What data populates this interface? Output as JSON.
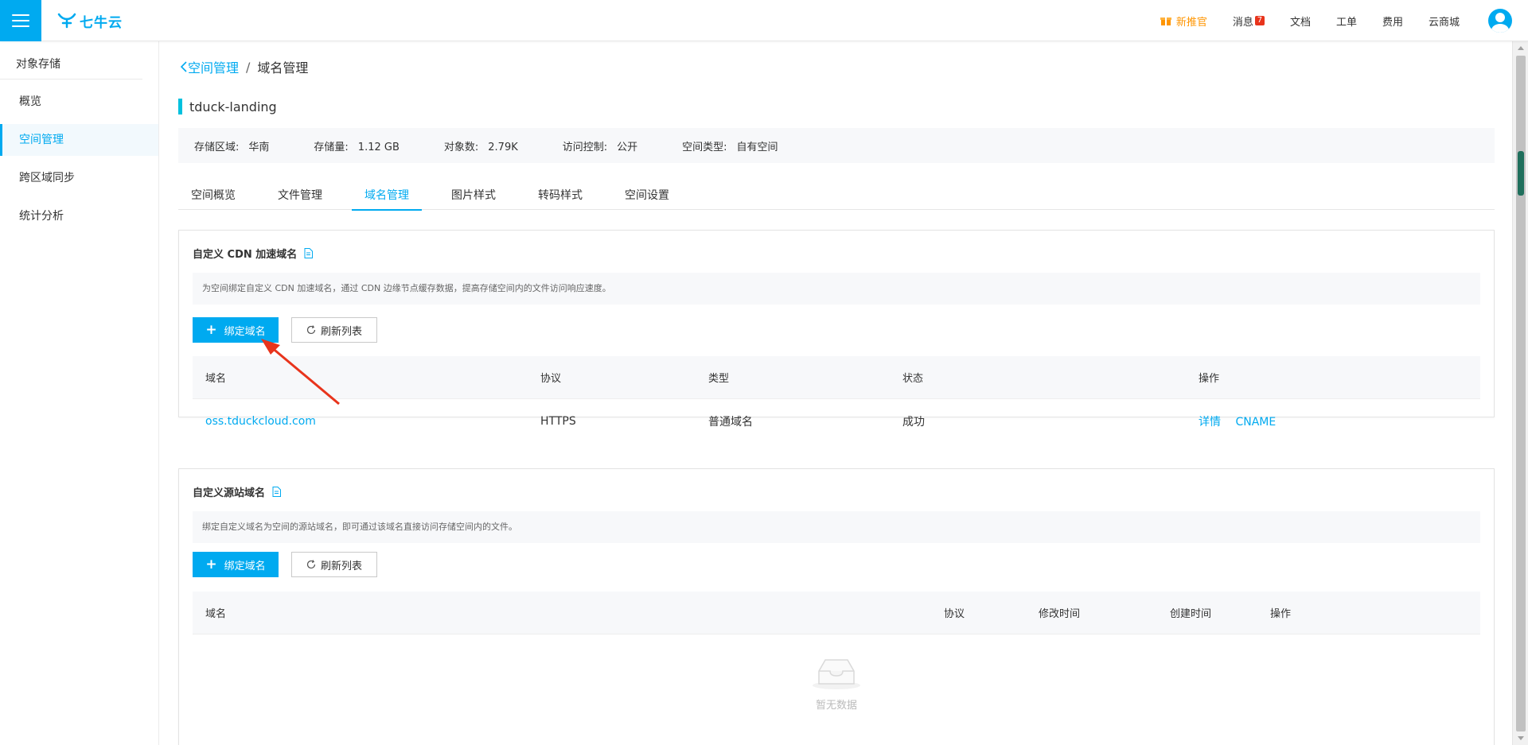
{
  "header": {
    "logo_text": "七牛云",
    "nav": {
      "promo": "新推官",
      "messages": "消息",
      "messages_badge": "7",
      "docs": "文档",
      "tickets": "工单",
      "billing": "费用",
      "store": "云商城"
    }
  },
  "sidebar": {
    "title": "对象存储",
    "items": [
      {
        "label": "概览"
      },
      {
        "label": "空间管理",
        "active": true
      },
      {
        "label": "跨区域同步"
      },
      {
        "label": "统计分析"
      }
    ]
  },
  "breadcrumb": {
    "back": "空间管理",
    "separator": "/",
    "current": "域名管理"
  },
  "bucket": {
    "name": "tduck-landing",
    "info": [
      {
        "key": "存储区域:",
        "value": "华南"
      },
      {
        "key": "存储量:",
        "value": "1.12 GB"
      },
      {
        "key": "对象数:",
        "value": "2.79K"
      },
      {
        "key": "访问控制:",
        "value": "公开"
      },
      {
        "key": "空间类型:",
        "value": "自有空间"
      }
    ]
  },
  "tabs": [
    {
      "label": "空间概览"
    },
    {
      "label": "文件管理"
    },
    {
      "label": "域名管理",
      "active": true
    },
    {
      "label": "图片样式"
    },
    {
      "label": "转码样式"
    },
    {
      "label": "空间设置"
    }
  ],
  "cdn_section": {
    "title": "自定义 CDN 加速域名",
    "description": "为空间绑定自定义 CDN 加速域名，通过 CDN 边缘节点缓存数据，提高存储空间内的文件访问响应速度。",
    "bind_button": "绑定域名",
    "refresh_button": "刷新列表",
    "columns": [
      "域名",
      "协议",
      "类型",
      "状态",
      "操作"
    ],
    "rows": [
      {
        "domain": "oss.tduckcloud.com",
        "protocol": "HTTPS",
        "type": "普通域名",
        "status": "成功",
        "op_detail": "详情",
        "op_cname": "CNAME"
      }
    ]
  },
  "origin_section": {
    "title": "自定义源站域名",
    "description": "绑定自定义域名为空间的源站域名，即可通过该域名直接访问存储空间内的文件。",
    "bind_button": "绑定域名",
    "refresh_button": "刷新列表",
    "columns": [
      "域名",
      "协议",
      "修改时间",
      "创建时间",
      "操作"
    ],
    "empty_text": "暂无数据"
  },
  "colors": {
    "accent": "#00aaf0",
    "bucket_bar": "#00c1de",
    "promo": "#ff9500",
    "arrow": "#e8341c"
  }
}
